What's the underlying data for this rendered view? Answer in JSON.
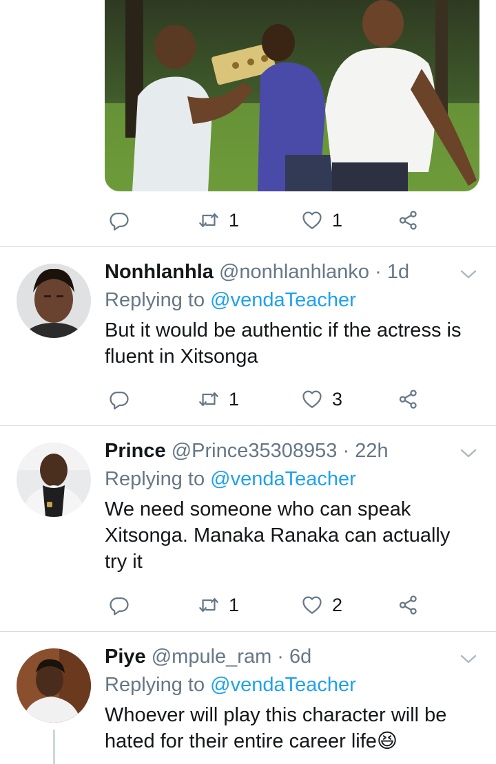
{
  "top_tweet": {
    "actions": {
      "retweet_count": "1",
      "like_count": "1"
    }
  },
  "replies": [
    {
      "name": "Nonhlanhla",
      "handle": "@nonhlanhlanko",
      "sep": " · ",
      "time": "1d",
      "replying_prefix": "Replying to ",
      "replying_to": "@vendaTeacher",
      "text": "But it would be authentic if the actress is fluent in Xitsonga",
      "retweet_count": "1",
      "like_count": "3"
    },
    {
      "name": "Prince",
      "handle": "@Prince35308953",
      "sep": " · ",
      "time": "22h",
      "replying_prefix": "Replying to ",
      "replying_to": "@vendaTeacher",
      "text": "We need someone who can speak Xitsonga. Manaka Ranaka can actually try it",
      "retweet_count": "1",
      "like_count": "2"
    },
    {
      "name": "Piye",
      "handle": "@mpule_ram",
      "sep": " · ",
      "time": "6d",
      "replying_prefix": "Replying to ",
      "replying_to": "@vendaTeacher",
      "text": "Whoever will play this character will be hated for their entire career life😆"
    }
  ],
  "colors": {
    "secondary_text": "#657786",
    "link": "#1da1f2",
    "divider": "#d9dde1",
    "primary_text": "#14171a"
  },
  "icons": [
    "reply-icon",
    "retweet-icon",
    "like-icon",
    "share-icon",
    "chevron-down-icon"
  ]
}
